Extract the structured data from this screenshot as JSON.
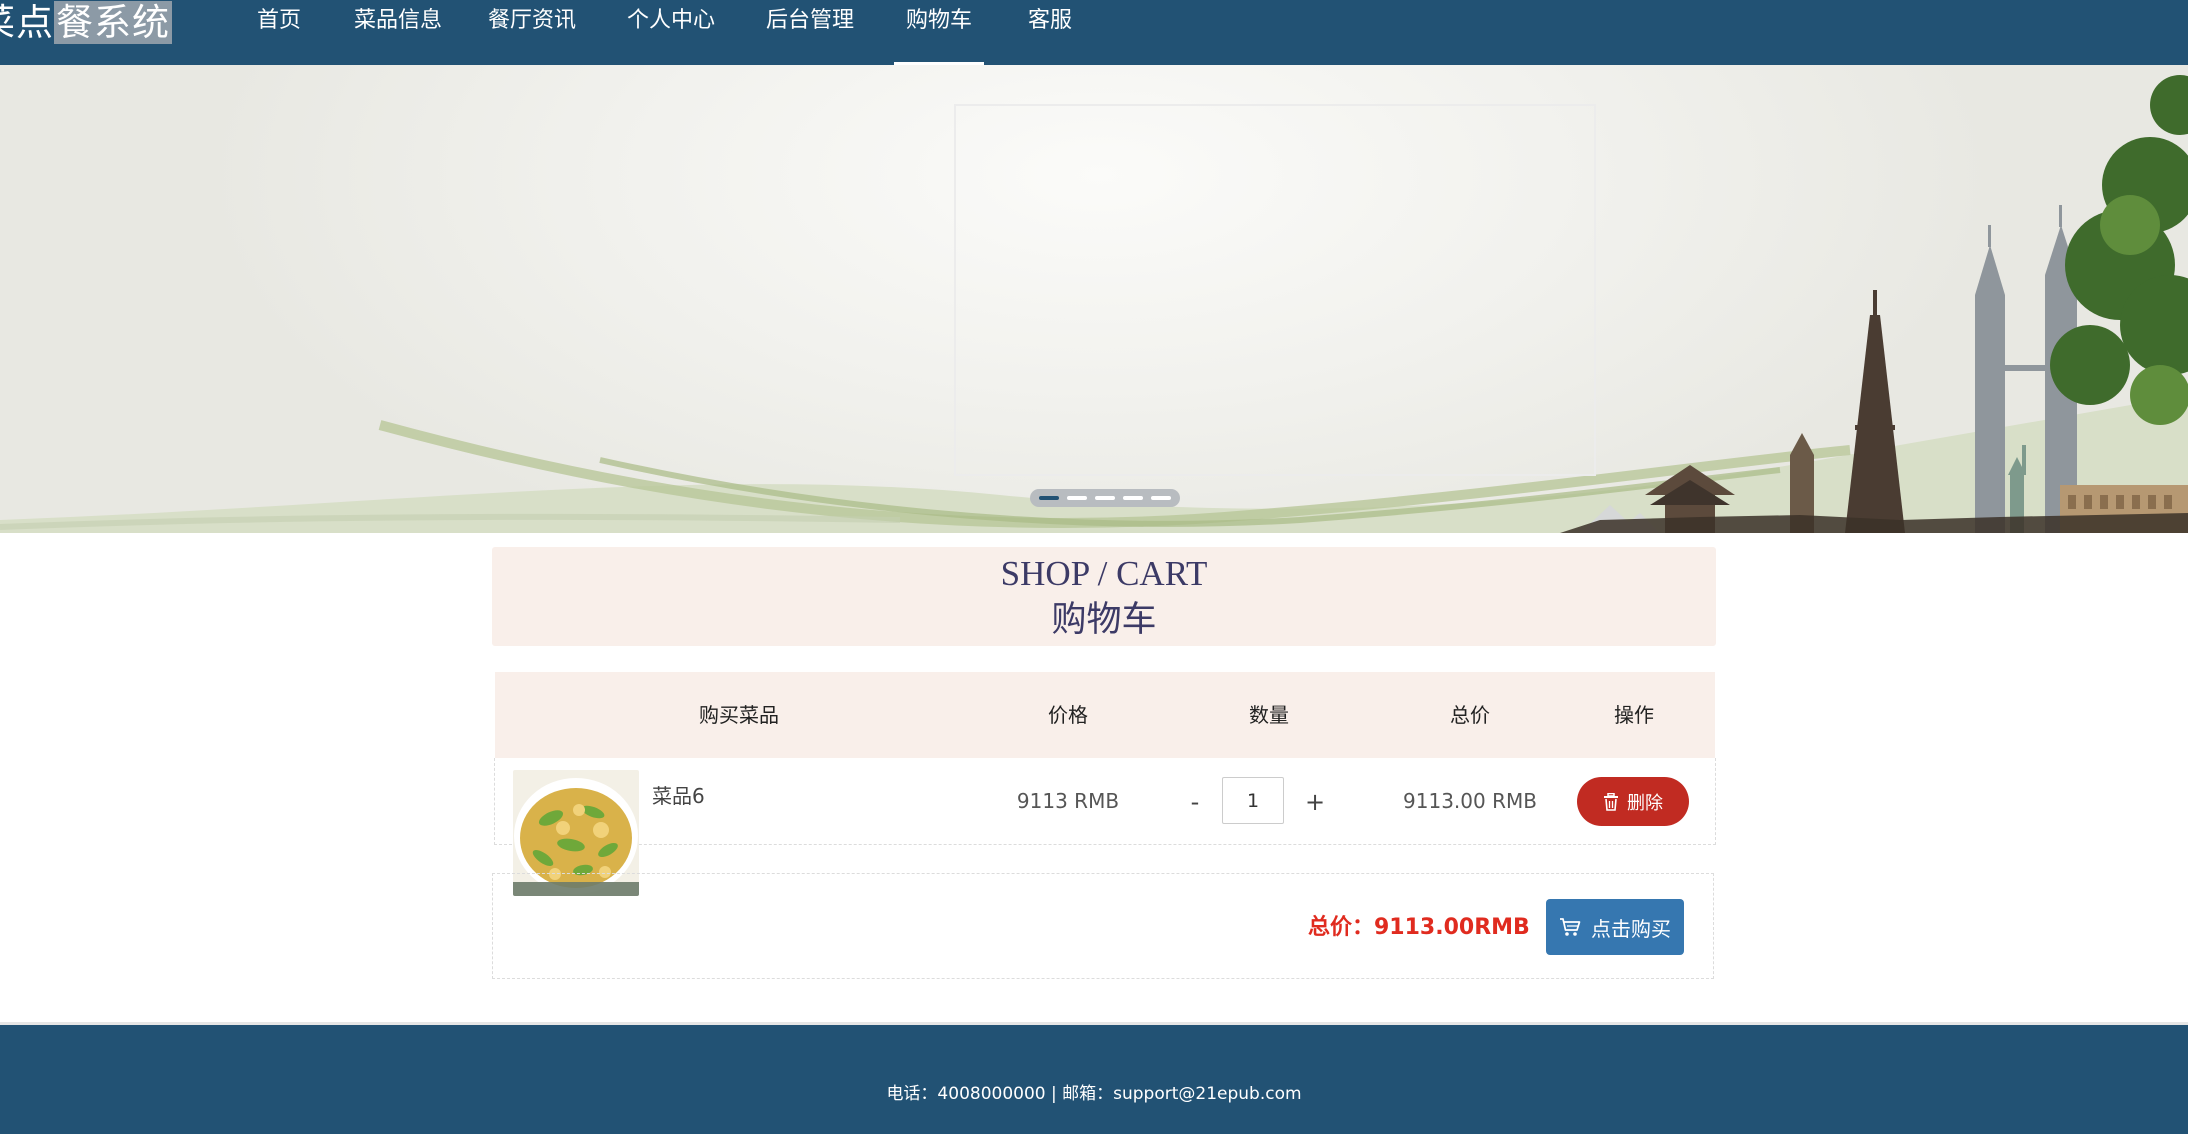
{
  "header": {
    "brand_cut": "菜点",
    "brand_highlight": "餐系统",
    "nav": [
      {
        "label": "首页"
      },
      {
        "label": "菜品信息"
      },
      {
        "label": "餐厅资讯"
      },
      {
        "label": "个人中心"
      },
      {
        "label": "后台管理"
      },
      {
        "label": "购物车"
      },
      {
        "label": "客服"
      }
    ],
    "active_nav": "购物车"
  },
  "banner": {
    "carousel_count": 5,
    "carousel_active_index": 0
  },
  "cart": {
    "title_en": "SHOP / CART",
    "title_zh": "购物车",
    "columns": [
      "购买菜品",
      "价格",
      "数量",
      "总价",
      "操作"
    ],
    "items": [
      {
        "name": "菜品6",
        "price": "9113 RMB",
        "quantity": "1",
        "qty_minus": "-",
        "qty_plus": "+",
        "subtotal": "9113.00 RMB",
        "delete_label": "删除"
      }
    ],
    "total_text": "总价：9113.00RMB",
    "buy_label": "点击购买"
  },
  "footer": {
    "text": "电话：4008000000 | 邮箱：support@21epub.com"
  },
  "colors": {
    "nav_bg": "#225274",
    "title_bg": "#f9efea",
    "delete_red": "#c12b22",
    "buy_blue": "#3677b0",
    "total_red": "#e02b1f"
  },
  "icons": [
    "trash-icon",
    "cart-icon"
  ]
}
